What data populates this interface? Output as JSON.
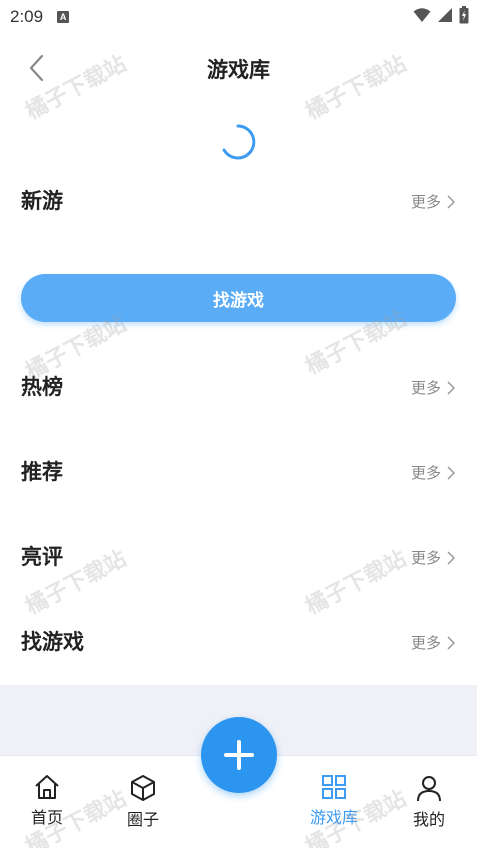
{
  "status_bar": {
    "time": "2:09",
    "notification_icon_letter": "A"
  },
  "nav": {
    "title": "游戏库",
    "back_icon": "chevron-left-icon"
  },
  "sections": [
    {
      "title": "新游",
      "more": "更多"
    },
    {
      "title": "热榜",
      "more": "更多"
    },
    {
      "title": "推荐",
      "more": "更多"
    },
    {
      "title": "亮评",
      "more": "更多"
    },
    {
      "title": "找游戏",
      "more": "更多"
    }
  ],
  "find_button": {
    "label": "找游戏"
  },
  "tab_bar": {
    "tabs": [
      {
        "label": "首页",
        "icon": "home-icon",
        "active": false
      },
      {
        "label": "圈子",
        "icon": "cube-icon",
        "active": false
      },
      {
        "label": "游戏库",
        "icon": "grid-icon",
        "active": true
      },
      {
        "label": "我的",
        "icon": "person-icon",
        "active": false
      }
    ],
    "fab_icon": "plus-icon"
  },
  "watermark": {
    "text": "橘子下载站"
  },
  "colors": {
    "accent": "#2c95f0",
    "button": "#5aacf7",
    "active_tab": "#3d9bf2",
    "grey_area": "#f0f1f6"
  }
}
